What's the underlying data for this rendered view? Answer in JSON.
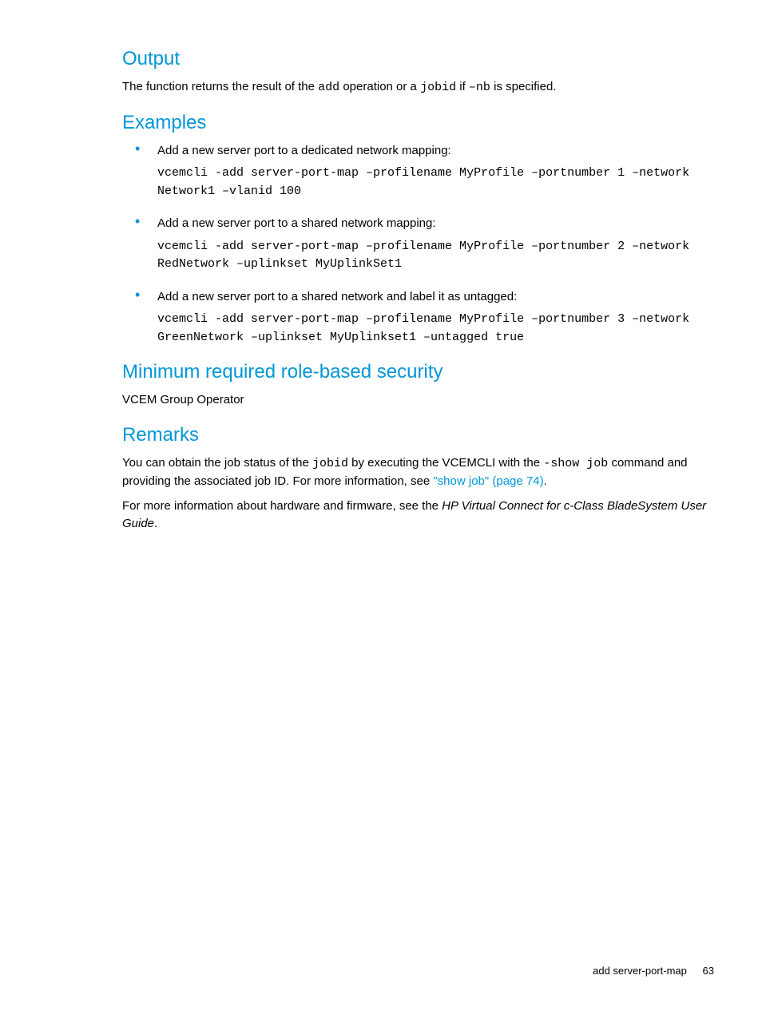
{
  "sections": {
    "output": {
      "heading": "Output",
      "para_pre": "The function returns the result of the ",
      "code1": "add",
      "mid1": " operation or a ",
      "code2": "jobid",
      "mid2": " if ",
      "code3": "–nb",
      "post": " is specified."
    },
    "examples": {
      "heading": "Examples",
      "items": [
        {
          "text": "Add a new server port to a dedicated network mapping:",
          "code": "vcemcli -add server-port-map –profilename MyProfile –portnumber 1 –network Network1 –vlanid 100"
        },
        {
          "text": "Add a new server port to a shared network mapping:",
          "code": "vcemcli -add server-port-map –profilename MyProfile –portnumber 2 –network RedNetwork –uplinkset MyUplinkSet1"
        },
        {
          "text": "Add a new server port to a shared network and label it as untagged:",
          "code": "vcemcli -add server-port-map –profilename MyProfile –portnumber 3 –network GreenNetwork –uplinkset MyUplinkset1 –untagged true"
        }
      ]
    },
    "security": {
      "heading": "Minimum required role-based security",
      "text": "VCEM Group Operator"
    },
    "remarks": {
      "heading": "Remarks",
      "p1_pre": "You can obtain the job status of the ",
      "p1_code1": "jobid",
      "p1_mid1": " by executing the VCEMCLI with the ",
      "p1_code2": "-show job",
      "p1_mid2": " command and providing the associated job ID. For more information, see ",
      "p1_link": "\"show job\" (page 74)",
      "p1_post": ".",
      "p2_pre": "For more information about hardware and firmware, see the ",
      "p2_italic": "HP Virtual Connect for c-Class BladeSystem User Guide",
      "p2_post": "."
    }
  },
  "footer": {
    "title": "add server-port-map",
    "page": "63"
  }
}
